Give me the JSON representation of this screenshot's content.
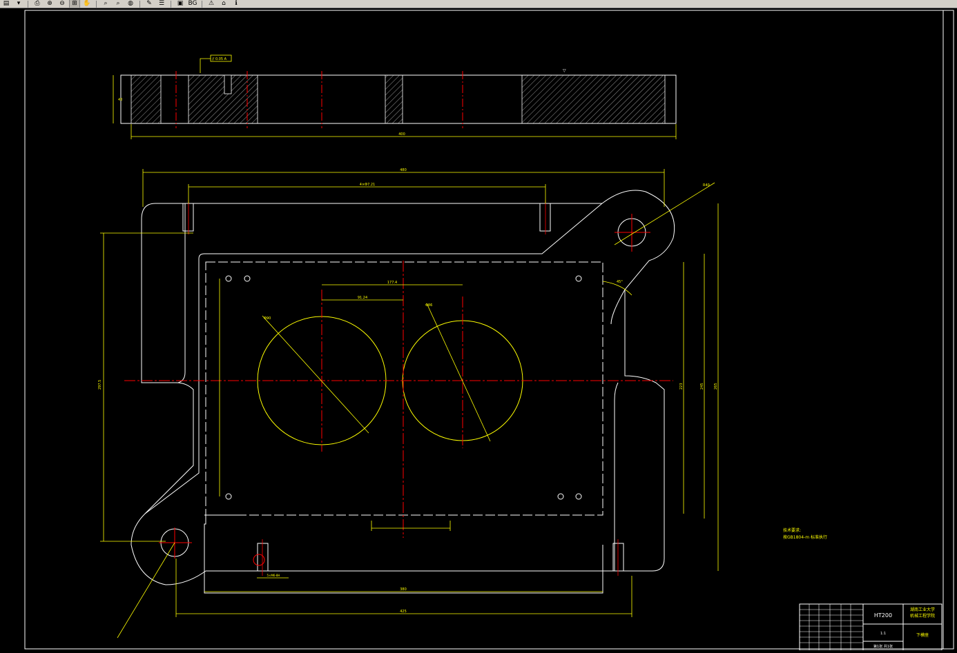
{
  "toolbar": {
    "buttons": [
      {
        "name": "menu-icon",
        "glyph": "▤"
      },
      {
        "name": "dropdown-chevron-icon",
        "glyph": "▾"
      },
      {
        "name": "print-icon",
        "glyph": "⎙"
      },
      {
        "name": "zoom-in-icon",
        "glyph": "⊕"
      },
      {
        "name": "zoom-out-icon",
        "glyph": "⊖"
      },
      {
        "name": "zoom-window-icon",
        "glyph": "⊞"
      },
      {
        "name": "pan-hand-icon",
        "glyph": "✋"
      },
      {
        "name": "zoom-extents-icon",
        "glyph": "⌕"
      },
      {
        "name": "zoom-previous-icon",
        "glyph": "⌕"
      },
      {
        "name": "globe-icon",
        "glyph": "◍"
      },
      {
        "name": "measure-icon",
        "glyph": "✎"
      },
      {
        "name": "layers-icon",
        "glyph": "☰"
      },
      {
        "name": "save-image-icon",
        "glyph": "▣"
      },
      {
        "name": "home-icon",
        "glyph": "⌂"
      },
      {
        "name": "info-icon",
        "glyph": "ℹ"
      }
    ],
    "bg_label": "BG"
  },
  "colors": {
    "background": "#000000",
    "geometry": "#ffffff",
    "dimension": "#ffff00",
    "centerline": "#ff0000"
  },
  "drawing": {
    "top_view_dims": {
      "tolerance_frame": "// 0.05 A",
      "overall_length": "400",
      "thickness": "40"
    },
    "front_view_dims": {
      "overall_width": "480",
      "hole_spacing": "4×Φ7.21",
      "radius_large": "R40",
      "height_left": "297.5",
      "dim_center_a": "177.4",
      "dim_center_b": "91.24",
      "circle_a": "Φ90",
      "circle_b": "Φ86",
      "bottom_width_1": "380",
      "bottom_width_2": "425",
      "small_dim": "5×M6-8H",
      "angle": "45°",
      "right_height_1": "223",
      "right_height_2": "245",
      "right_height_3": "265"
    },
    "notes": {
      "title": "技术要求:",
      "line1": "按GB1804-m 标准执行"
    },
    "title_block": {
      "material": "HT200",
      "school": "湖南工业大学",
      "department": "机械工程学院",
      "part_name": "下模座",
      "scale": "1:1",
      "sheet": "第1张 共1张"
    }
  }
}
